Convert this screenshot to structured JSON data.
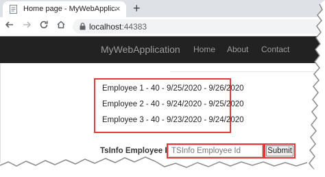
{
  "browser": {
    "tab": {
      "title": "Home page - MyWebApplication",
      "close_glyph": "×",
      "favicon": "page-icon"
    },
    "new_tab_glyph": "+",
    "address": {
      "host": "localhost",
      "port": ":44383"
    },
    "icons": {
      "back": "back-arrow-icon",
      "forward": "forward-arrow-icon",
      "reload": "reload-icon",
      "home": "home-icon",
      "lock": "lock-icon"
    }
  },
  "navbar": {
    "brand": "MyWebApplication",
    "links": [
      {
        "label": "Home"
      },
      {
        "label": "About"
      },
      {
        "label": "Contact"
      }
    ]
  },
  "employees": [
    "Employee 1 - 40 - 9/25/2020 - 9/26/2020",
    "Employee 2 - 40 - 9/24/2020 - 9/25/2020",
    "Employee 3 - 40 - 9/23/2020 - 9/24/2020"
  ],
  "form": {
    "label": "TsInfo Employee Id",
    "input_value": "",
    "input_placeholder": "TSInfo Employee Id",
    "submit_label": "Submit"
  },
  "colors": {
    "highlight": "#e23a3a",
    "navbar_bg": "#222222",
    "navbar_text": "#9d9d9d"
  }
}
